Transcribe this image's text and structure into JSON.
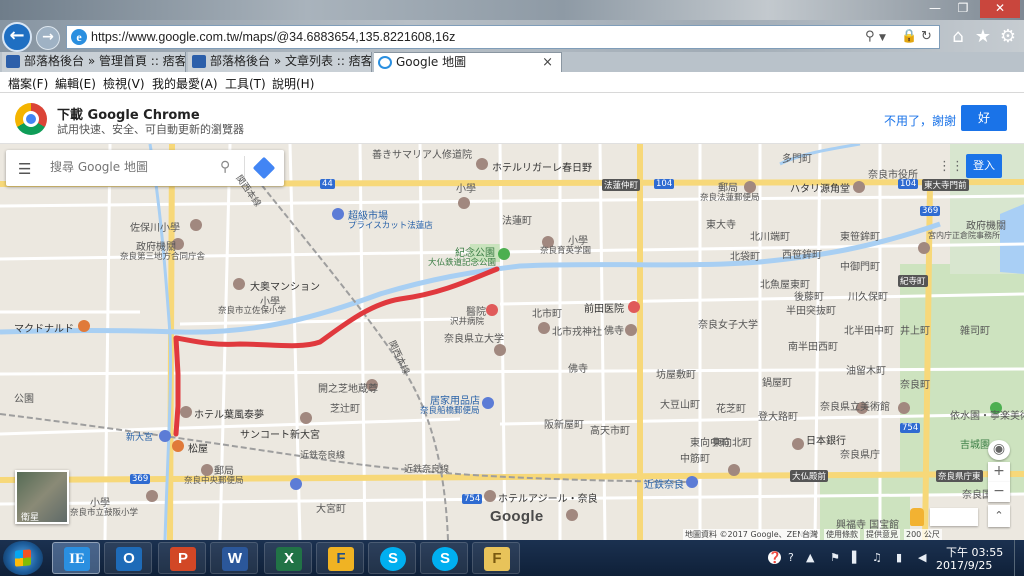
{
  "window": {
    "minimize": "—",
    "maximize": "❐",
    "close": "✕"
  },
  "browser": {
    "url": "https://www.google.com.tw/maps/@34.6883654,135.8221608,16z",
    "tabs": [
      {
        "label": "部落格後台 » 管理首頁 :: 痞客..."
      },
      {
        "label": "部落格後台 » 文章列表 :: 痞客..."
      },
      {
        "label": "Google 地圖"
      }
    ],
    "tab_close": "×",
    "menu": [
      "檔案(F)",
      "編輯(E)",
      "檢視(V)",
      "我的最愛(A)",
      "工具(T)",
      "說明(H)"
    ]
  },
  "promo": {
    "title": "下載 Google Chrome",
    "subtitle": "試用快速、安全、可自動更新的瀏覽器",
    "dismiss": "不用了，謝謝",
    "accept": "好"
  },
  "map": {
    "search_placeholder": "搜尋 Google 地圖",
    "signin": "登入",
    "satellite_label": "衛星",
    "google_logo": "Google",
    "attribution": [
      "地圖資料 ©2017 Google、ZENRIN",
      "台灣",
      "使用條款",
      "提供意見",
      "200 公尺"
    ],
    "labels": {
      "l1": "善きサマリア人修道院",
      "l2": "ホテルリガーレ春日野",
      "l3": "多門町",
      "l4": "奈良市役所",
      "l5": "佐保川小學",
      "l6": "政府機關",
      "l7": "奈良第三地方合同庁舎",
      "l8": "超級市場",
      "l9": "プライスカット法蓮店",
      "l10": "小學",
      "l11": "法蓮町",
      "l12": "紀念公園",
      "l13": "大仏鉄道記念公園",
      "l14": "小學",
      "l15": "奈良育英学園",
      "l16": "郵局",
      "l17": "奈良法蓮郵便局",
      "l18": "ハタリ源角堂",
      "l19": "政府機關",
      "l20": "宮内庁正倉院事務所",
      "l21": "大奥マンション",
      "l22": "小學",
      "l23": "奈良市立佐保小学",
      "l24": "マクドナルド",
      "l25": "醫院",
      "l26": "沢井病院",
      "l27": "北市町",
      "l28": "前田医院",
      "l29": "奈良県立大学",
      "l30": "北市戎神社",
      "l31": "佛寺",
      "l32": "奈良女子大学",
      "l33": "開之芝地蔵尊",
      "l34": "居家用品店",
      "l35": "奈良船橋郵便局",
      "l36": "佛寺",
      "l37": "坊屋敷町",
      "l38": "公園",
      "l39": "ホテル葉風泰夢",
      "l40": "サンコート新大宮",
      "l41": "新大宮",
      "l42": "松屋",
      "l43": "近鉄奈良線",
      "l44": "近鉄奈良線",
      "l45": "日本銀行",
      "l46": "奈良県立美術館",
      "l47": "依水園・寧楽美術館",
      "l48": "吉城園",
      "l49": "郵局",
      "l50": "奈良中央郵便局",
      "l51": "小學",
      "l52": "奈良市立鼓阪小学",
      "l53": "近鉄奈良",
      "l54": "ホテルアジール・奈良",
      "l55": "興福寺 国宝館",
      "l56": "奈良国立",
      "l57": "関西本線",
      "l58": "関西本線",
      "l59": "芝辻町",
      "l60": "大宮町",
      "l61": "東向北町",
      "l62": "高天市町",
      "l63": "登大路町",
      "l64": "花芝町",
      "l65": "東大寺",
      "l66": "北袋町",
      "l67": "半田突抜町",
      "l68": "南半田西町",
      "l69": "北半田中町",
      "l70": "油留木町",
      "l71": "鍋屋町",
      "l72": "川久保町",
      "l73": "東笹鉾町",
      "l74": "中御門町",
      "l75": "北魚屋東町",
      "l76": "後藤町",
      "l77": "井上町",
      "l78": "雑司町",
      "l79": "奈良県庁",
      "l80": "阪新屋町",
      "l81": "西笹鉾町",
      "l82": "北川端町",
      "l83": "奈良町",
      "l84": "大豆山町",
      "l85": "中筋町",
      "l86": "東向中町"
    },
    "roads": [
      "44",
      "104",
      "104",
      "369",
      "754",
      "369",
      "754",
      "法蓮仲町",
      "東大寺門前",
      "紀寺町",
      "大仏殿前",
      "奈良県庁東"
    ]
  },
  "taskbar": {
    "apps": [
      "IE",
      "O",
      "P",
      "W",
      "X",
      "F",
      "S",
      "S",
      "F"
    ],
    "tray": [
      "❓",
      "?",
      "▲",
      "⚑",
      "▌",
      "♫",
      "▮",
      "◀"
    ],
    "time": "下午 03:55",
    "date": "2017/9/25"
  }
}
